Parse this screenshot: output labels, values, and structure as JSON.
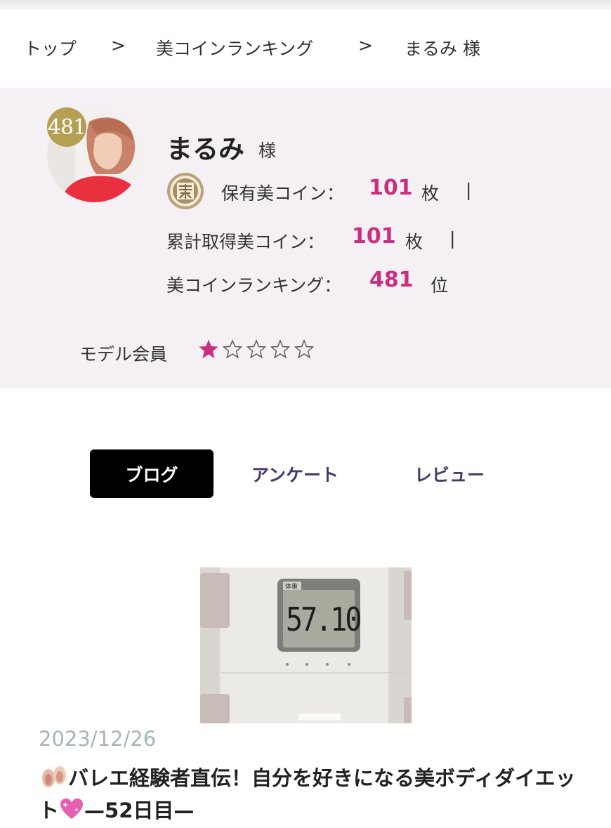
{
  "breadcrumb": {
    "home": "トップ",
    "separator": ">",
    "ranking": "美コインランキング",
    "current": "まるみ 様"
  },
  "profile": {
    "rank_badge": "481",
    "name": "まるみ",
    "suffix": "様",
    "held_coins_label": "保有美コイン：",
    "held_coins_value": "101",
    "held_coins_unit": "枚",
    "total_coins_label": "累計取得美コイン：",
    "total_coins_value": "101",
    "total_coins_unit": "枚",
    "ranking_label": "美コインランキング：",
    "ranking_value": "481",
    "ranking_unit": "位",
    "divider": "|",
    "model_label": "モデル会員",
    "model_rating": 1,
    "model_rating_max": 5
  },
  "tabs": [
    {
      "label": "ブログ",
      "active": true
    },
    {
      "label": "アンケート",
      "active": false
    },
    {
      "label": "レビュー",
      "active": false
    }
  ],
  "post": {
    "date": "2023/12/26",
    "title_part1": "バレエ経験者直伝！自分を好きになる美ボディダイエット",
    "title_part2": "—52日目—",
    "image_display": "57.10",
    "image_label": "体重"
  },
  "colors": {
    "accent": "#c8307f",
    "panel_bg": "#f4f0f4",
    "badge_gold": "#b4a052",
    "tab_text": "#4a3a6a",
    "date_gray": "#a8b4bd"
  },
  "icons": {
    "coin": "bi-coin-icon",
    "star_filled": "star-filled-icon",
    "star_empty": "star-empty-icon"
  }
}
